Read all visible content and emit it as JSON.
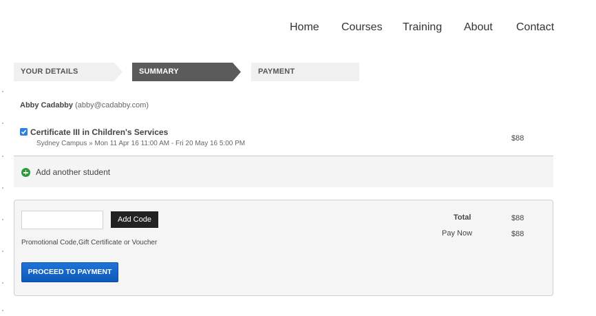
{
  "nav": {
    "items": [
      "Home",
      "Courses",
      "Training",
      "About",
      "Contact"
    ]
  },
  "steps": [
    {
      "label": "YOUR DETAILS",
      "active": false
    },
    {
      "label": "SUMMARY",
      "active": true
    },
    {
      "label": "PAYMENT",
      "active": false
    }
  ],
  "student": {
    "name": "Abby Cadabby",
    "email": "(abby@cadabby.com)"
  },
  "course": {
    "checked": true,
    "title": "Certificate III in Children's Services",
    "details": "Sydney Campus » Mon 11 Apr 16 11:00 AM - Fri 20 May 16 5:00 PM",
    "price": "$88"
  },
  "add_student": {
    "label": "Add another student",
    "icon": "plus-circle-icon"
  },
  "promo": {
    "input_value": "",
    "button_label": "Add Code",
    "hint": "Promotional Code,Gift Certificate or Voucher"
  },
  "payment": {
    "button_label": "PROCEED TO PAYMENT",
    "total_label": "Total",
    "total_value": "$88",
    "pay_now_label": "Pay Now",
    "pay_now_value": "$88"
  },
  "colors": {
    "active_step": "#5b5b5b",
    "pay_button": "#0e58b8",
    "add_icon": "#2f9a3c",
    "checkbox": "#2d7fe0"
  }
}
